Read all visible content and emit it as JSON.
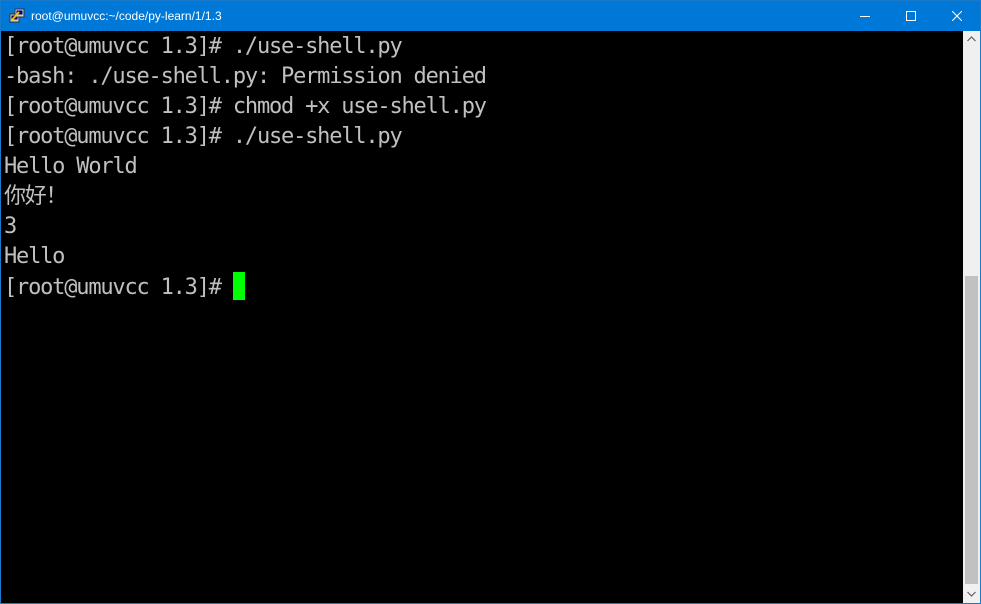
{
  "window": {
    "title": "root@umuvcc:~/code/py-learn/1/1.3",
    "app_icon": "putty-icon",
    "controls": {
      "minimize_icon": "minimize-icon",
      "maximize_icon": "maximize-icon",
      "close_icon": "close-icon"
    },
    "accent_color": "#0078d7"
  },
  "terminal": {
    "background": "#000000",
    "foreground": "#c0c0c0",
    "cursor_color": "#00ff00",
    "lines": [
      "[root@umuvcc 1.3]# ./use-shell.py",
      "-bash: ./use-shell.py: Permission denied",
      "[root@umuvcc 1.3]# chmod +x use-shell.py",
      "[root@umuvcc 1.3]# ./use-shell.py",
      "Hello World",
      "你好！",
      "3",
      "Hello",
      "[root@umuvcc 1.3]#"
    ]
  },
  "scrollbar": {
    "up_icon": "scroll-up-arrow-icon",
    "down_icon": "scroll-down-arrow-icon"
  }
}
